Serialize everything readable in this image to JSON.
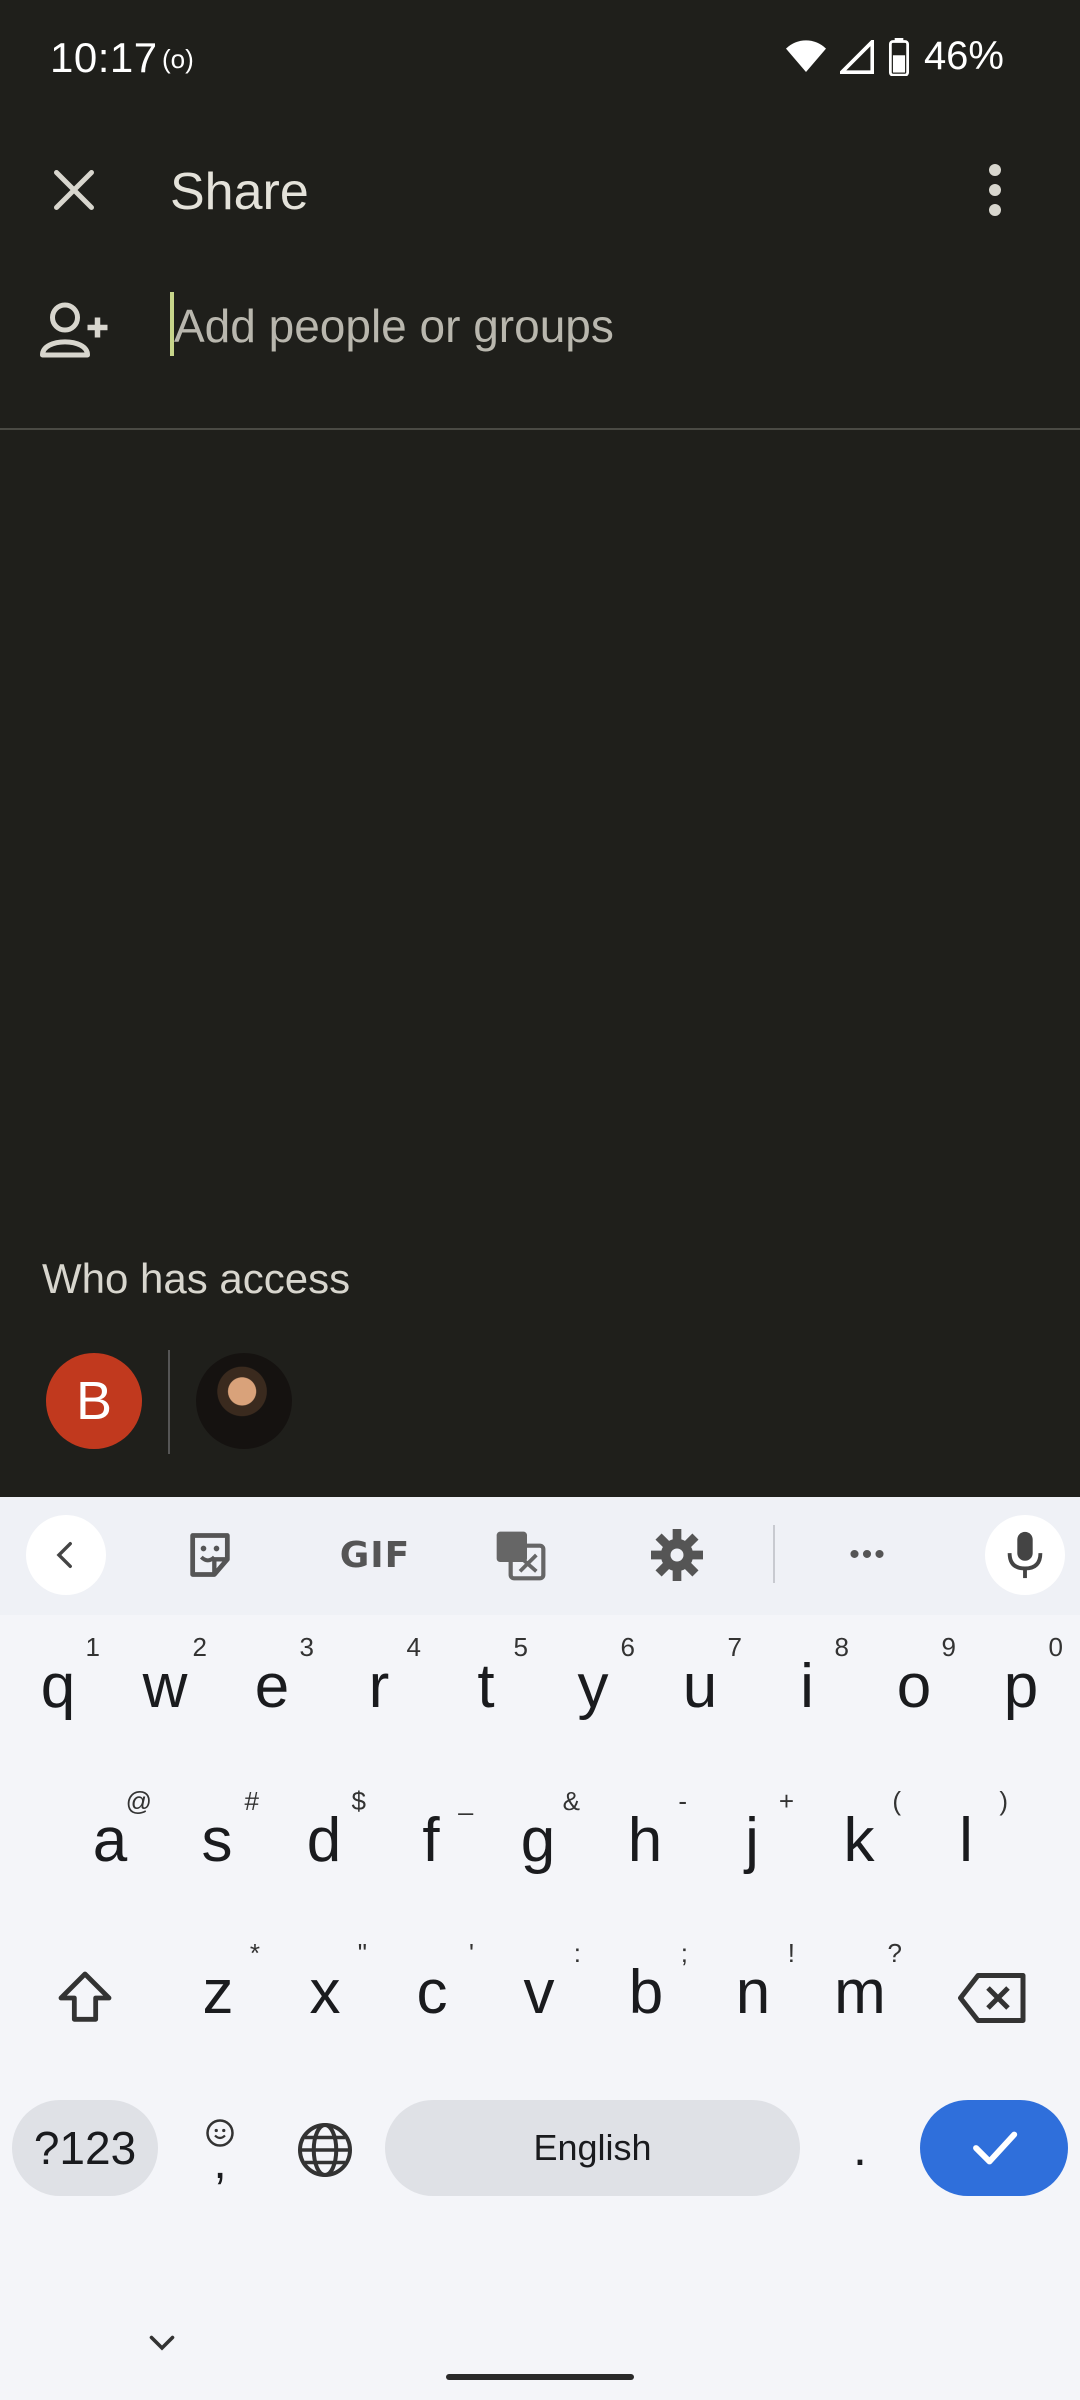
{
  "status": {
    "time": "10:17",
    "hotspot": "(o)",
    "battery": "46%"
  },
  "header": {
    "title": "Share"
  },
  "add_field": {
    "placeholder": "Add people or groups"
  },
  "access": {
    "title": "Who has access",
    "avatar_initial": "B"
  },
  "keyboard": {
    "toolbar": {
      "gif_label": "GIF",
      "more_label": "•••"
    },
    "row1": [
      {
        "key": "q",
        "hint": "1"
      },
      {
        "key": "w",
        "hint": "2"
      },
      {
        "key": "e",
        "hint": "3"
      },
      {
        "key": "r",
        "hint": "4"
      },
      {
        "key": "t",
        "hint": "5"
      },
      {
        "key": "y",
        "hint": "6"
      },
      {
        "key": "u",
        "hint": "7"
      },
      {
        "key": "i",
        "hint": "8"
      },
      {
        "key": "o",
        "hint": "9"
      },
      {
        "key": "p",
        "hint": "0"
      }
    ],
    "row2": [
      {
        "key": "a",
        "hint": "@"
      },
      {
        "key": "s",
        "hint": "#"
      },
      {
        "key": "d",
        "hint": "$"
      },
      {
        "key": "f",
        "hint": "_"
      },
      {
        "key": "g",
        "hint": "&"
      },
      {
        "key": "h",
        "hint": "-"
      },
      {
        "key": "j",
        "hint": "+"
      },
      {
        "key": "k",
        "hint": "("
      },
      {
        "key": "l",
        "hint": ")"
      }
    ],
    "row3": [
      {
        "key": "z",
        "hint": "*"
      },
      {
        "key": "x",
        "hint": "\""
      },
      {
        "key": "c",
        "hint": "'"
      },
      {
        "key": "v",
        "hint": ":"
      },
      {
        "key": "b",
        "hint": ";"
      },
      {
        "key": "n",
        "hint": "!"
      },
      {
        "key": "m",
        "hint": "?"
      }
    ],
    "symbols_label": "?123",
    "comma_label": ",",
    "space_label": "English",
    "period_label": "."
  },
  "colors": {
    "background": "#1f1f1b",
    "avatar_b": "#c1391e",
    "enter_key": "#2f6fdb",
    "caret": "#c7d58a"
  },
  "icons": [
    "close-icon",
    "more-vert-icon",
    "add-person-icon",
    "back-icon",
    "sticker-icon",
    "translate-icon",
    "settings-icon",
    "mic-icon",
    "shift-icon",
    "backspace-icon",
    "emoji-icon",
    "globe-icon",
    "check-icon",
    "chevron-down-icon",
    "wifi-icon",
    "signal-icon",
    "battery-icon"
  ]
}
